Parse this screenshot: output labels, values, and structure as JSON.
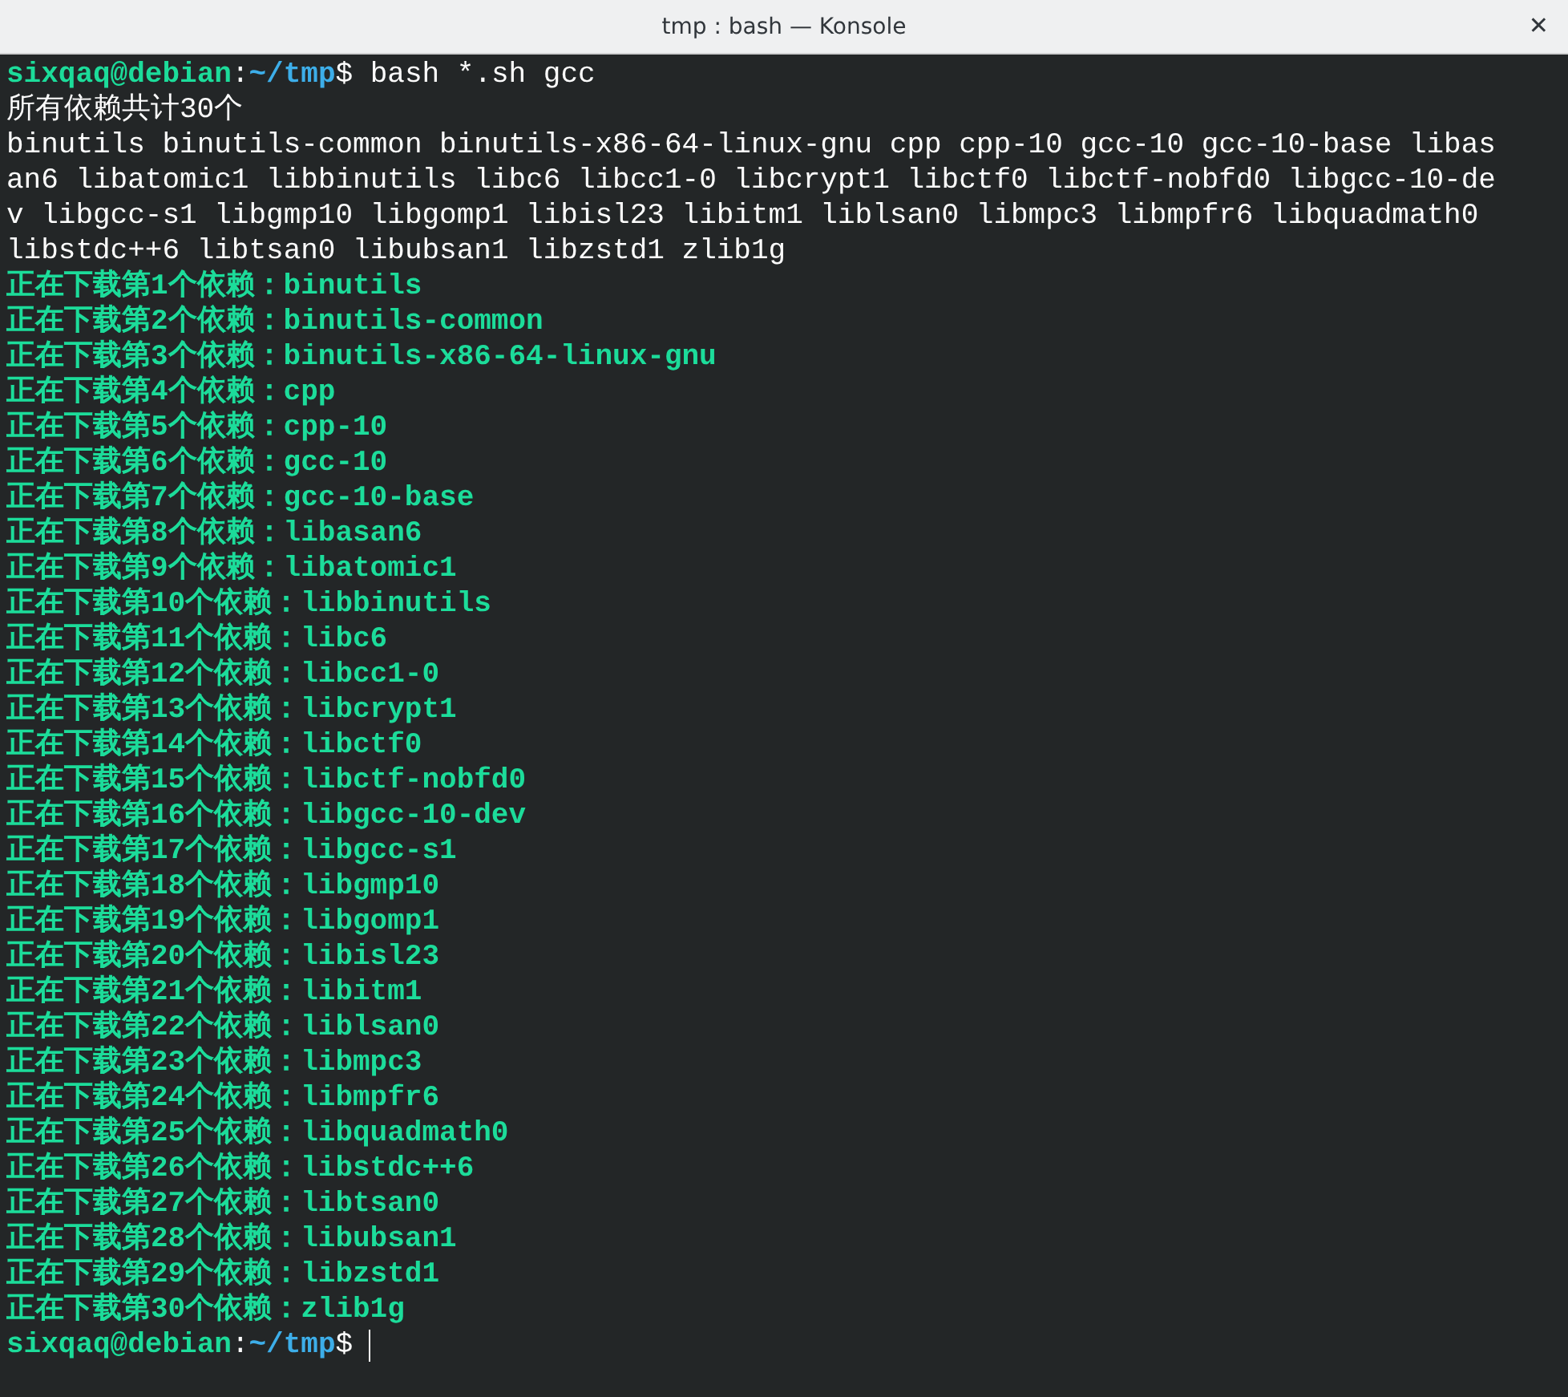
{
  "window": {
    "title": "tmp : bash — Konsole",
    "close_glyph": "✕"
  },
  "terminal": {
    "lines": [
      {
        "kind": "prompt",
        "user_host": "sixqaq@debian",
        "separator": ":",
        "path": "~/tmp",
        "symbol": "$",
        "command": " bash *.sh gcc"
      },
      {
        "kind": "plain",
        "text": "所有依赖共计30个"
      },
      {
        "kind": "plain",
        "text": "binutils binutils-common binutils-x86-64-linux-gnu cpp cpp-10 gcc-10 gcc-10-base libas"
      },
      {
        "kind": "plain",
        "text": "an6 libatomic1 libbinutils libc6 libcc1-0 libcrypt1 libctf0 libctf-nobfd0 libgcc-10-de"
      },
      {
        "kind": "plain",
        "text": "v libgcc-s1 libgmp10 libgomp1 libisl23 libitm1 liblsan0 libmpc3 libmpfr6 libquadmath0"
      },
      {
        "kind": "plain",
        "text": "libstdc++6 libtsan0 libubsan1 libzstd1 zlib1g"
      },
      {
        "kind": "progress",
        "text": "正在下载第1个依赖：binutils"
      },
      {
        "kind": "progress",
        "text": "正在下载第2个依赖：binutils-common"
      },
      {
        "kind": "progress",
        "text": "正在下载第3个依赖：binutils-x86-64-linux-gnu"
      },
      {
        "kind": "progress",
        "text": "正在下载第4个依赖：cpp"
      },
      {
        "kind": "progress",
        "text": "正在下载第5个依赖：cpp-10"
      },
      {
        "kind": "progress",
        "text": "正在下载第6个依赖：gcc-10"
      },
      {
        "kind": "progress",
        "text": "正在下载第7个依赖：gcc-10-base"
      },
      {
        "kind": "progress",
        "text": "正在下载第8个依赖：libasan6"
      },
      {
        "kind": "progress",
        "text": "正在下载第9个依赖：libatomic1"
      },
      {
        "kind": "progress",
        "text": "正在下载第10个依赖：libbinutils"
      },
      {
        "kind": "progress",
        "text": "正在下载第11个依赖：libc6"
      },
      {
        "kind": "progress",
        "text": "正在下载第12个依赖：libcc1-0"
      },
      {
        "kind": "progress",
        "text": "正在下载第13个依赖：libcrypt1"
      },
      {
        "kind": "progress",
        "text": "正在下载第14个依赖：libctf0"
      },
      {
        "kind": "progress",
        "text": "正在下载第15个依赖：libctf-nobfd0"
      },
      {
        "kind": "progress",
        "text": "正在下载第16个依赖：libgcc-10-dev"
      },
      {
        "kind": "progress",
        "text": "正在下载第17个依赖：libgcc-s1"
      },
      {
        "kind": "progress",
        "text": "正在下载第18个依赖：libgmp10"
      },
      {
        "kind": "progress",
        "text": "正在下载第19个依赖：libgomp1"
      },
      {
        "kind": "progress",
        "text": "正在下载第20个依赖：libisl23"
      },
      {
        "kind": "progress",
        "text": "正在下载第21个依赖：libitm1"
      },
      {
        "kind": "progress",
        "text": "正在下载第22个依赖：liblsan0"
      },
      {
        "kind": "progress",
        "text": "正在下载第23个依赖：libmpc3"
      },
      {
        "kind": "progress",
        "text": "正在下载第24个依赖：libmpfr6"
      },
      {
        "kind": "progress",
        "text": "正在下载第25个依赖：libquadmath0"
      },
      {
        "kind": "progress",
        "text": "正在下载第26个依赖：libstdc++6"
      },
      {
        "kind": "progress",
        "text": "正在下载第27个依赖：libtsan0"
      },
      {
        "kind": "progress",
        "text": "正在下载第28个依赖：libubsan1"
      },
      {
        "kind": "progress",
        "text": "正在下载第29个依赖：libzstd1"
      },
      {
        "kind": "progress",
        "text": "正在下载第30个依赖：zlib1g"
      },
      {
        "kind": "prompt",
        "user_host": "sixqaq@debian",
        "separator": ":",
        "path": "~/tmp",
        "symbol": "$",
        "cursor": true
      }
    ]
  }
}
